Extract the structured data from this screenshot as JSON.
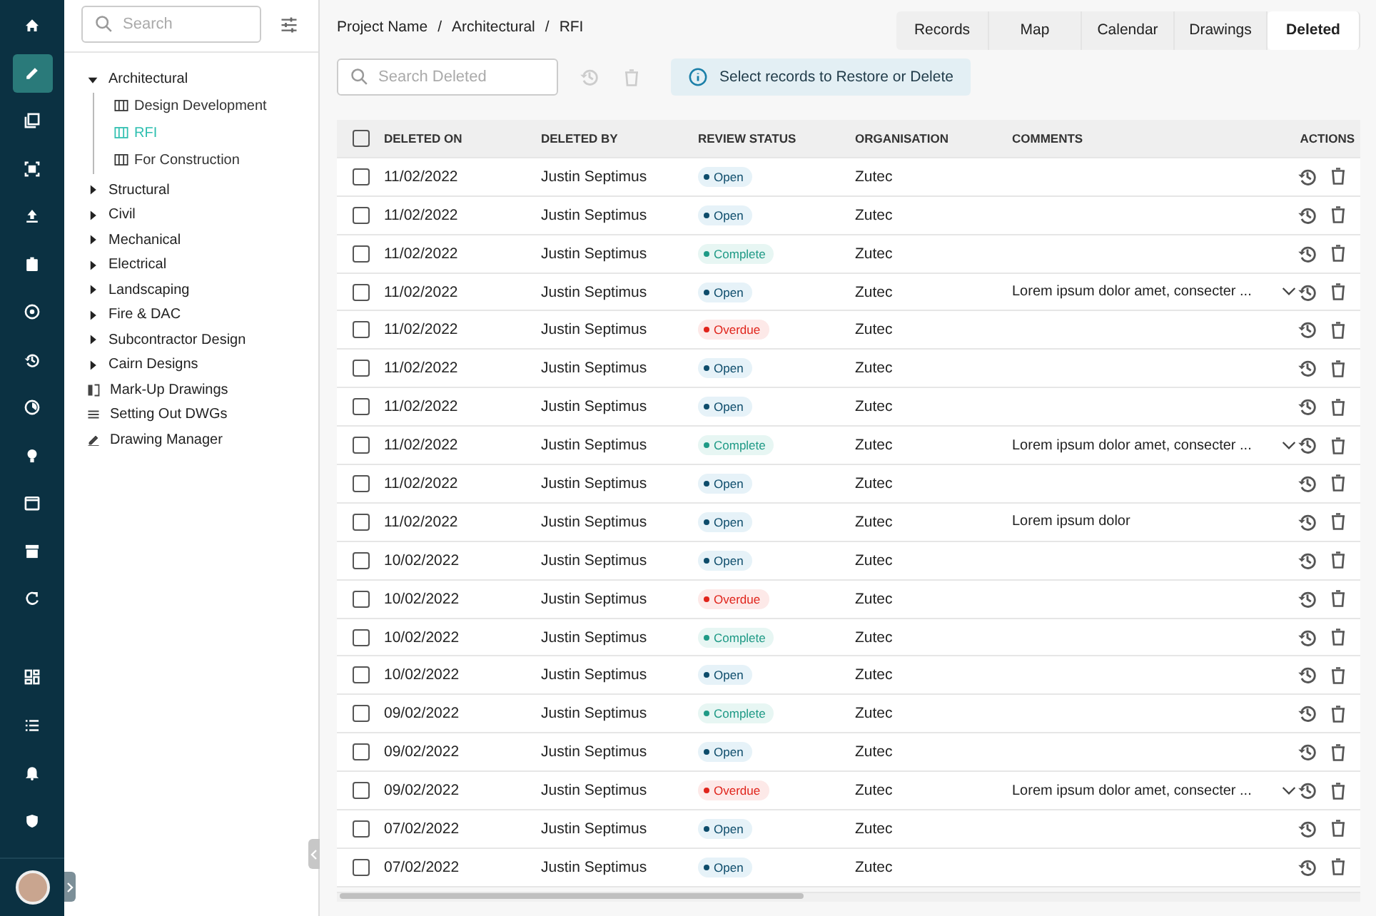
{
  "rail": [
    {
      "kind": "home",
      "selected": false
    },
    {
      "kind": "pencil",
      "selected": true
    },
    {
      "kind": "documents",
      "selected": false
    },
    {
      "kind": "scan",
      "selected": false
    },
    {
      "kind": "upload",
      "selected": false
    },
    {
      "kind": "clipboard",
      "selected": false
    },
    {
      "kind": "target",
      "selected": false
    },
    {
      "kind": "history",
      "selected": false
    },
    {
      "kind": "chart",
      "selected": false
    },
    {
      "kind": "bulb",
      "selected": false
    },
    {
      "kind": "calendar",
      "selected": false
    },
    {
      "kind": "archive",
      "selected": false
    },
    {
      "kind": "refresh",
      "selected": false
    }
  ],
  "rail_bottom": [
    {
      "kind": "dashboard",
      "selected": false
    },
    {
      "kind": "list",
      "selected": false
    },
    {
      "kind": "bell",
      "selected": false
    },
    {
      "kind": "shield",
      "selected": false
    }
  ],
  "tree_search": {
    "placeholder": "Search"
  },
  "tree": [
    {
      "label": "Architectural",
      "kind": "folder",
      "expanded": true,
      "children": [
        {
          "label": "Design Development",
          "kind": "board",
          "selected": false
        },
        {
          "label": "RFI",
          "kind": "board",
          "selected": true
        },
        {
          "label": "For Construction",
          "kind": "board",
          "selected": false
        }
      ]
    },
    {
      "label": "Structural",
      "kind": "folder",
      "expanded": false
    },
    {
      "label": "Civil",
      "kind": "folder",
      "expanded": false
    },
    {
      "label": "Mechanical",
      "kind": "folder",
      "expanded": false
    },
    {
      "label": "Electrical",
      "kind": "folder",
      "expanded": false
    },
    {
      "label": "Landscaping",
      "kind": "folder",
      "expanded": false
    },
    {
      "label": "Fire & DAC",
      "kind": "folder",
      "expanded": false
    },
    {
      "label": "Subcontractor Design",
      "kind": "folder",
      "expanded": false
    },
    {
      "label": "Cairn Designs",
      "kind": "folder",
      "expanded": false
    },
    {
      "label": "Mark-Up Drawings",
      "kind": "markup"
    },
    {
      "label": "Setting Out DWGs",
      "kind": "list"
    },
    {
      "label": "Drawing Manager",
      "kind": "manager"
    }
  ],
  "breadcrumb": [
    "Project Name",
    "Architectural",
    "RFI"
  ],
  "breadcrumb_separator": "/",
  "tabs": [
    {
      "label": "Records",
      "selected": false
    },
    {
      "label": "Map",
      "selected": false
    },
    {
      "label": "Calendar",
      "selected": false
    },
    {
      "label": "Drawings",
      "selected": false
    },
    {
      "label": "Deleted",
      "selected": true
    }
  ],
  "search": {
    "placeholder": "Search Deleted"
  },
  "info": "Select records to Restore or Delete",
  "table": {
    "all_checked": false,
    "columns": [
      "DELETED ON",
      "DELETED BY",
      "REVIEW STATUS",
      "ORGANISATION",
      "COMMENTS",
      "ACTIONS"
    ],
    "rows": [
      {
        "date": "11/02/2022",
        "by": "Justin Septimus",
        "status": "Open",
        "kind": "open",
        "org": "Zutec",
        "comment": "",
        "expandable": false,
        "checked": false
      },
      {
        "date": "11/02/2022",
        "by": "Justin Septimus",
        "status": "Open",
        "kind": "open",
        "org": "Zutec",
        "comment": "",
        "expandable": false,
        "checked": false
      },
      {
        "date": "11/02/2022",
        "by": "Justin Septimus",
        "status": "Complete",
        "kind": "complete",
        "org": "Zutec",
        "comment": "",
        "expandable": false,
        "checked": false
      },
      {
        "date": "11/02/2022",
        "by": "Justin Septimus",
        "status": "Open",
        "kind": "open",
        "org": "Zutec",
        "comment": "Lorem ipsum dolor  amet, consecter ...",
        "expandable": true,
        "checked": false
      },
      {
        "date": "11/02/2022",
        "by": "Justin Septimus",
        "status": "Overdue",
        "kind": "overdue",
        "org": "Zutec",
        "comment": "",
        "expandable": false,
        "checked": false
      },
      {
        "date": "11/02/2022",
        "by": "Justin Septimus",
        "status": "Open",
        "kind": "open",
        "org": "Zutec",
        "comment": "",
        "expandable": false,
        "checked": false
      },
      {
        "date": "11/02/2022",
        "by": "Justin Septimus",
        "status": "Open",
        "kind": "open",
        "org": "Zutec",
        "comment": "",
        "expandable": false,
        "checked": false
      },
      {
        "date": "11/02/2022",
        "by": "Justin Septimus",
        "status": "Complete",
        "kind": "complete",
        "org": "Zutec",
        "comment": "Lorem ipsum dolor  amet, consecter ...",
        "expandable": true,
        "checked": false
      },
      {
        "date": "11/02/2022",
        "by": "Justin Septimus",
        "status": "Open",
        "kind": "open",
        "org": "Zutec",
        "comment": "",
        "expandable": false,
        "checked": false
      },
      {
        "date": "11/02/2022",
        "by": "Justin Septimus",
        "status": "Open",
        "kind": "open",
        "org": "Zutec",
        "comment": "Lorem ipsum dolor",
        "expandable": false,
        "checked": false
      },
      {
        "date": "10/02/2022",
        "by": "Justin Septimus",
        "status": "Open",
        "kind": "open",
        "org": "Zutec",
        "comment": "",
        "expandable": false,
        "checked": false
      },
      {
        "date": "10/02/2022",
        "by": "Justin Septimus",
        "status": "Overdue",
        "kind": "overdue",
        "org": "Zutec",
        "comment": "",
        "expandable": false,
        "checked": false
      },
      {
        "date": "10/02/2022",
        "by": "Justin Septimus",
        "status": "Complete",
        "kind": "complete",
        "org": "Zutec",
        "comment": "",
        "expandable": false,
        "checked": false
      },
      {
        "date": "10/02/2022",
        "by": "Justin Septimus",
        "status": "Open",
        "kind": "open",
        "org": "Zutec",
        "comment": "",
        "expandable": false,
        "checked": false
      },
      {
        "date": "09/02/2022",
        "by": "Justin Septimus",
        "status": "Complete",
        "kind": "complete",
        "org": "Zutec",
        "comment": "",
        "expandable": false,
        "checked": false
      },
      {
        "date": "09/02/2022",
        "by": "Justin Septimus",
        "status": "Open",
        "kind": "open",
        "org": "Zutec",
        "comment": "",
        "expandable": false,
        "checked": false
      },
      {
        "date": "09/02/2022",
        "by": "Justin Septimus",
        "status": "Overdue",
        "kind": "overdue",
        "org": "Zutec",
        "comment": "Lorem ipsum dolor  amet, consecter ...",
        "expandable": true,
        "checked": false
      },
      {
        "date": "07/02/2022",
        "by": "Justin Septimus",
        "status": "Open",
        "kind": "open",
        "org": "Zutec",
        "comment": "",
        "expandable": false,
        "checked": false
      },
      {
        "date": "07/02/2022",
        "by": "Justin Septimus",
        "status": "Open",
        "kind": "open",
        "org": "Zutec",
        "comment": "",
        "expandable": false,
        "checked": false
      }
    ]
  }
}
